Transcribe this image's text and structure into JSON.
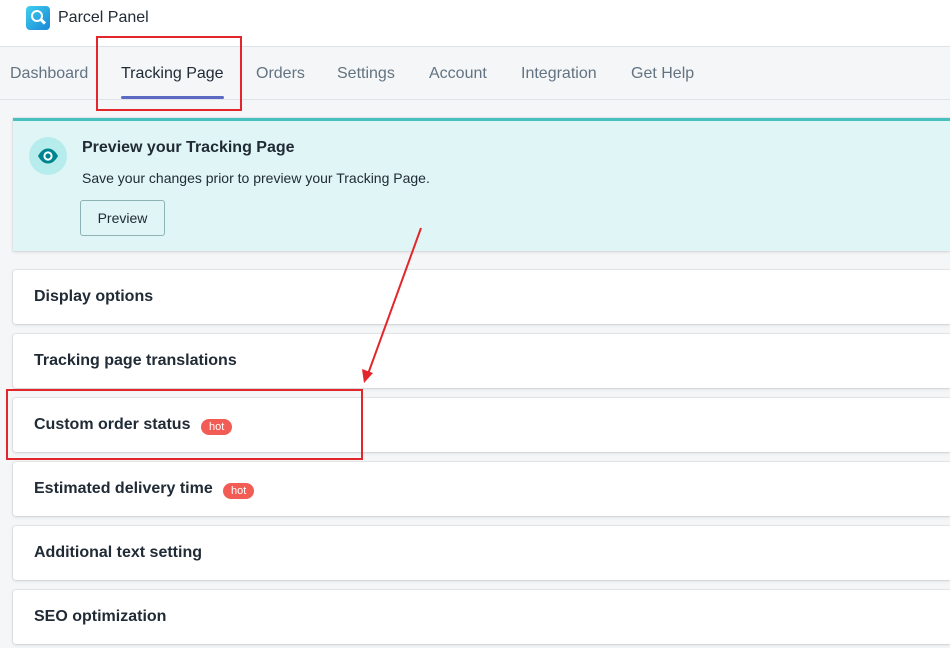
{
  "app": {
    "title": "Parcel Panel",
    "logo": "magnifier-logo"
  },
  "tabs": [
    {
      "label": "Dashboard",
      "active": false
    },
    {
      "label": "Tracking Page",
      "active": true
    },
    {
      "label": "Orders",
      "active": false
    },
    {
      "label": "Settings",
      "active": false
    },
    {
      "label": "Account",
      "active": false
    },
    {
      "label": "Integration",
      "active": false
    },
    {
      "label": "Get Help",
      "active": false
    }
  ],
  "banner": {
    "icon": "eye-icon",
    "title": "Preview your Tracking Page",
    "text": "Save your changes prior to preview your Tracking Page.",
    "button_label": "Preview"
  },
  "sections": [
    {
      "title": "Display options"
    },
    {
      "title": "Tracking page translations"
    },
    {
      "title": "Custom order status",
      "badge": "hot"
    },
    {
      "title": "Estimated delivery time",
      "badge": "hot"
    },
    {
      "title": "Additional text setting"
    },
    {
      "title": "SEO optimization"
    }
  ],
  "colors": {
    "accent": "#5c6ac4",
    "banner_bg": "#e0f5f5",
    "banner_border": "#47c1bf",
    "hot_badge": "#f25c54",
    "annotation": "#e3262b"
  }
}
